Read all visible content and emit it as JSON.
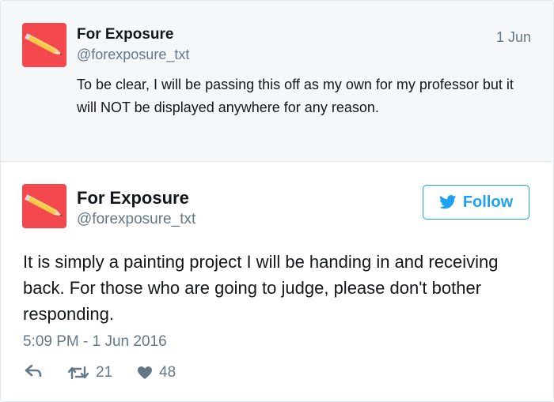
{
  "parent_tweet": {
    "name": "For Exposure",
    "handle": "@forexposure_txt",
    "date": "1 Jun",
    "text": "To be clear, I will be passing this off as my own for my professor but it will NOT be displayed anywhere for any reason."
  },
  "main_tweet": {
    "name": "For Exposure",
    "handle": "@forexposure_txt",
    "follow_label": "Follow",
    "text": "It is simply a painting project I will be handing in and receiving back. For those who are going to judge, please don't bother responding.",
    "timestamp": "5:09 PM - 1 Jun 2016",
    "retweet_count": "21",
    "like_count": "48"
  },
  "icons": {
    "avatar": "pencil-icon",
    "follow": "bird-icon",
    "reply": "reply-icon",
    "retweet": "retweet-icon",
    "like": "heart-icon"
  },
  "colors": {
    "avatar_bg": "#f4484f",
    "accent": "#1da1f2",
    "muted": "#657786",
    "parent_bg": "#f5f8fa"
  }
}
